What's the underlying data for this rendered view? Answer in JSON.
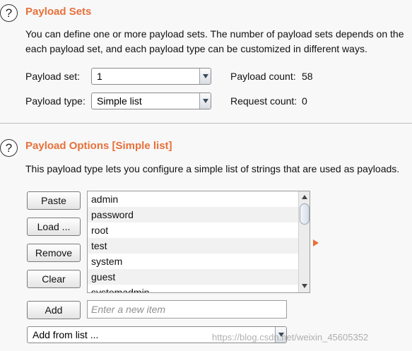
{
  "payload_sets": {
    "title": "Payload Sets",
    "description_line1": "You can define one or more payload sets. The number of payload sets depends on the",
    "description_line2": "each payload set, and each payload type can be customized in different ways.",
    "payload_set_label": "Payload set:",
    "payload_set_value": "1",
    "payload_type_label": "Payload type:",
    "payload_type_value": "Simple list",
    "payload_count_label": "Payload count:",
    "payload_count_value": "58",
    "request_count_label": "Request count:",
    "request_count_value": "0"
  },
  "payload_options": {
    "title": "Payload Options [Simple list]",
    "description": "This payload type lets you configure a simple list of strings that are used as payloads.",
    "buttons": {
      "paste": "Paste",
      "load": "Load ...",
      "remove": "Remove",
      "clear": "Clear",
      "add": "Add"
    },
    "items": [
      "admin",
      "password",
      "root",
      "test",
      "system",
      "guest",
      "systemadmin"
    ],
    "new_item_placeholder": "Enter a new item",
    "add_from_list": "Add from list ..."
  },
  "watermark": "https://blog.csdn.net/weixin_45605352",
  "colors": {
    "accent": "#e8703a"
  },
  "icons": [
    "help-icon",
    "dropdown-arrow-icon",
    "scroll-up-icon",
    "scroll-down-icon",
    "orange-arrow-icon"
  ]
}
